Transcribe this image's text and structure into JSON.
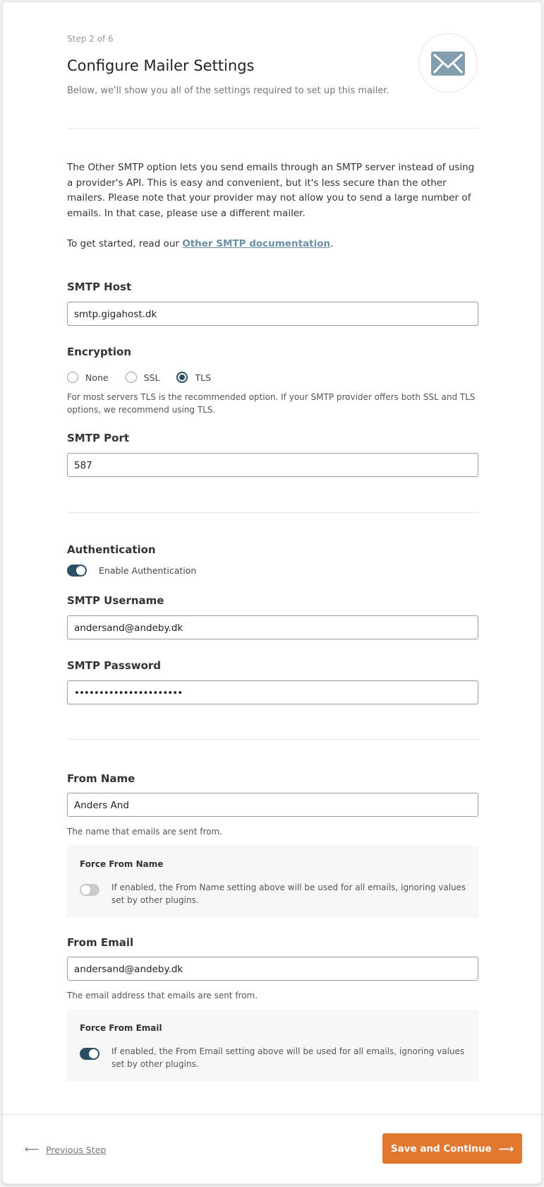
{
  "header": {
    "step": "Step 2 of 6",
    "title": "Configure Mailer Settings",
    "subtitle": "Below, we'll show you all of the settings required to set up this mailer.",
    "icon": "envelope-icon"
  },
  "intro": {
    "paragraph": "The Other SMTP option lets you send emails through an SMTP server instead of using a provider's API. This is easy and convenient, but it's less secure than the other mailers. Please note that your provider may not allow you to send a large number of emails. In that case, please use a different mailer.",
    "doc_prefix": "To get started, read our ",
    "doc_link": "Other SMTP documentation",
    "doc_suffix": "."
  },
  "smtp_host": {
    "label": "SMTP Host",
    "value": "smtp.gigahost.dk"
  },
  "encryption": {
    "label": "Encryption",
    "options": [
      "None",
      "SSL",
      "TLS"
    ],
    "selected": "TLS",
    "help": "For most servers TLS is the recommended option. If your SMTP provider offers both SSL and TLS options, we recommend using TLS."
  },
  "smtp_port": {
    "label": "SMTP Port",
    "value": "587"
  },
  "authentication": {
    "label": "Authentication",
    "toggle_label": "Enable Authentication",
    "enabled": true
  },
  "smtp_username": {
    "label": "SMTP Username",
    "value": "andersand@andeby.dk"
  },
  "smtp_password": {
    "label": "SMTP Password",
    "value": "••••••••••••••••••••••"
  },
  "from_name": {
    "label": "From Name",
    "value": "Anders And",
    "help": "The name that emails are sent from.",
    "force_title": "Force From Name",
    "force_text": "If enabled, the From Name setting above will be used for all emails, ignoring values set by other plugins.",
    "force_enabled": false
  },
  "from_email": {
    "label": "From Email",
    "value": "andersand@andeby.dk",
    "help": "The email address that emails are sent from.",
    "force_title": "Force From Email",
    "force_text": "If enabled, the From Email setting above will be used for all emails, ignoring values set by other plugins.",
    "force_enabled": true
  },
  "footer": {
    "prev_arrow": "⟵",
    "prev_label": "Previous Step",
    "save_label": "Save and Continue",
    "save_arrow": "⟶"
  },
  "colors": {
    "accent": "#e27730",
    "toggle_on": "#2d4f64",
    "link": "#6c8fa6",
    "icon": "#809eae"
  }
}
